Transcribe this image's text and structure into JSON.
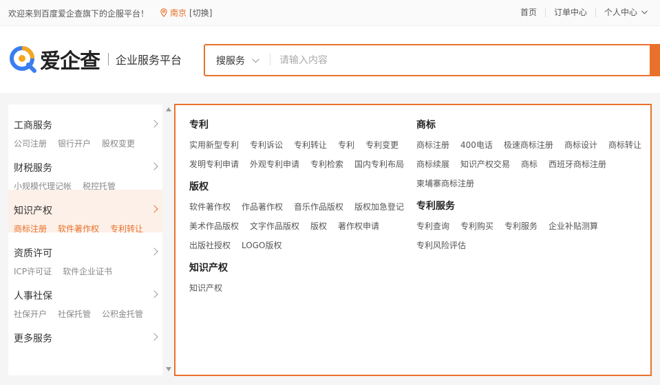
{
  "topbar": {
    "welcome": "欢迎来到百度爱企查旗下的企服平台！",
    "city": "南京",
    "switch": "[切换]",
    "nav": [
      "首页",
      "订单中心",
      "个人中心"
    ]
  },
  "header": {
    "logo_name": "爱企查",
    "logo_sub": "企业服务平台",
    "search_select": "搜服务",
    "search_placeholder": "请输入内容"
  },
  "sidebar": {
    "categories": [
      {
        "title": "工商服务",
        "links": [
          "公司注册",
          "银行开户",
          "股权变更"
        ]
      },
      {
        "title": "财税服务",
        "links": [
          "小规模代理记帐",
          "税控托管"
        ]
      },
      {
        "title": "知识产权",
        "links": [
          "商标注册",
          "软件著作权",
          "专利转让"
        ]
      },
      {
        "title": "资质许可",
        "links": [
          "ICP许可证",
          "软件企业证书"
        ]
      },
      {
        "title": "人事社保",
        "links": [
          "社保开户",
          "社保托管",
          "公积金托管"
        ]
      },
      {
        "title": "更多服务",
        "links": []
      }
    ]
  },
  "panel": {
    "left": [
      {
        "title": "专利",
        "links": [
          "实用新型专利",
          "专利诉讼",
          "专利转让",
          "专利",
          "专利变更",
          "发明专利申请",
          "外观专利申请",
          "专利检索",
          "国内专利布局"
        ]
      },
      {
        "title": "版权",
        "links": [
          "软件著作权",
          "作品著作权",
          "音乐作品版权",
          "版权加急登记",
          "美术作品版权",
          "文字作品版权",
          "版权",
          "著作权申请",
          "出版社授权",
          "LOGO版权"
        ]
      },
      {
        "title": "知识产权",
        "links": [
          "知识产权"
        ]
      }
    ],
    "right": [
      {
        "title": "商标",
        "links": [
          "商标注册",
          "400电话",
          "极速商标注册",
          "商标设计",
          "商标转让",
          "商标续展",
          "知识产权交易",
          "商标",
          "西班牙商标注册",
          "柬埔寨商标注册"
        ]
      },
      {
        "title": "专利服务",
        "links": [
          "专利查询",
          "专利购买",
          "专利服务",
          "企业补贴测算",
          "专利风险评估"
        ]
      }
    ]
  },
  "colors": {
    "accent": "#e9712b",
    "logo_blue": "#3a7df0"
  }
}
